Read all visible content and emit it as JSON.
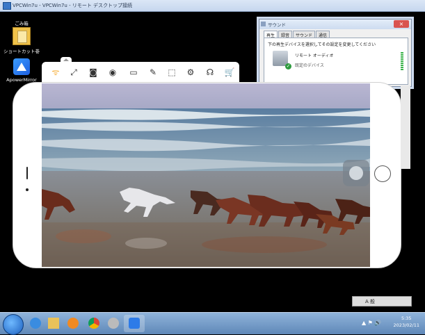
{
  "rdp": {
    "title": "VPCWin7u - VPCWin7u - リモート デスクトップ接続"
  },
  "desktop": {
    "icons": [
      {
        "label": "ごみ箱"
      },
      {
        "label": "ショートカット巻"
      },
      {
        "label": "ApowerMirror"
      }
    ]
  },
  "sound_dialog": {
    "title": "サウンド",
    "tabs": [
      "再生",
      "録音",
      "サウンド",
      "通信"
    ],
    "instruction": "下の再生デバイスを選択してその設定を変更してください",
    "device_name": "リモート オーディオ",
    "device_status": "既定のデバイス"
  },
  "toolbar": {
    "icons": [
      "wifi-icon",
      "fullscreen-icon",
      "screenshot-icon",
      "record-icon",
      "screen-cast-icon",
      "draw-icon",
      "crop-icon",
      "settings-icon",
      "headset-icon",
      "cart-icon"
    ]
  },
  "taskbar": {
    "time": "5:35",
    "date": "2023/02/11"
  },
  "langbar": {
    "text": "A 般"
  }
}
